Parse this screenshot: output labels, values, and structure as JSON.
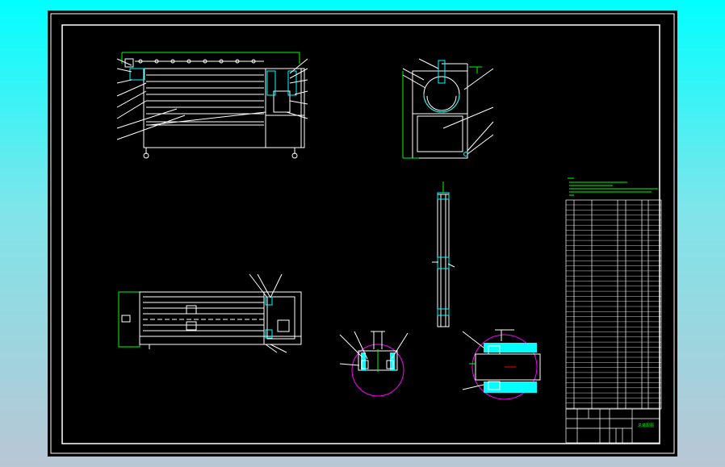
{
  "colors": {
    "background": "#000000",
    "line": "#ffffff",
    "accent_green": "#00ff00",
    "accent_cyan": "#00ffff",
    "accent_magenta": "#ff00ff",
    "accent_red": "#ff0000"
  },
  "title_block": {
    "drawing_title": "总装配图"
  }
}
